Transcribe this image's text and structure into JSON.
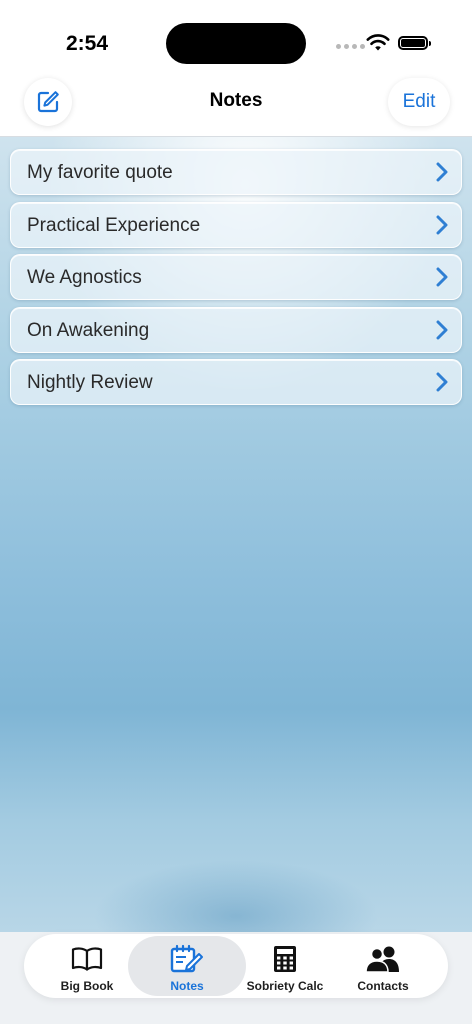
{
  "status_bar": {
    "time": "2:54"
  },
  "nav": {
    "title": "Notes",
    "edit_label": "Edit",
    "compose_icon": "compose-icon"
  },
  "notes": [
    {
      "title": "My favorite quote"
    },
    {
      "title": "Practical Experience"
    },
    {
      "title": "We Agnostics"
    },
    {
      "title": "On Awakening"
    },
    {
      "title": "Nightly Review"
    }
  ],
  "tabs": [
    {
      "label": "Big Book",
      "icon": "book-icon",
      "active": false
    },
    {
      "label": "Notes",
      "icon": "notepad-icon",
      "active": true
    },
    {
      "label": "Sobriety Calc",
      "icon": "calculator-icon",
      "active": false
    },
    {
      "label": "Contacts",
      "icon": "contacts-icon",
      "active": false
    }
  ],
  "colors": {
    "accent": "#1a73d9",
    "text": "#2a2a2a"
  }
}
